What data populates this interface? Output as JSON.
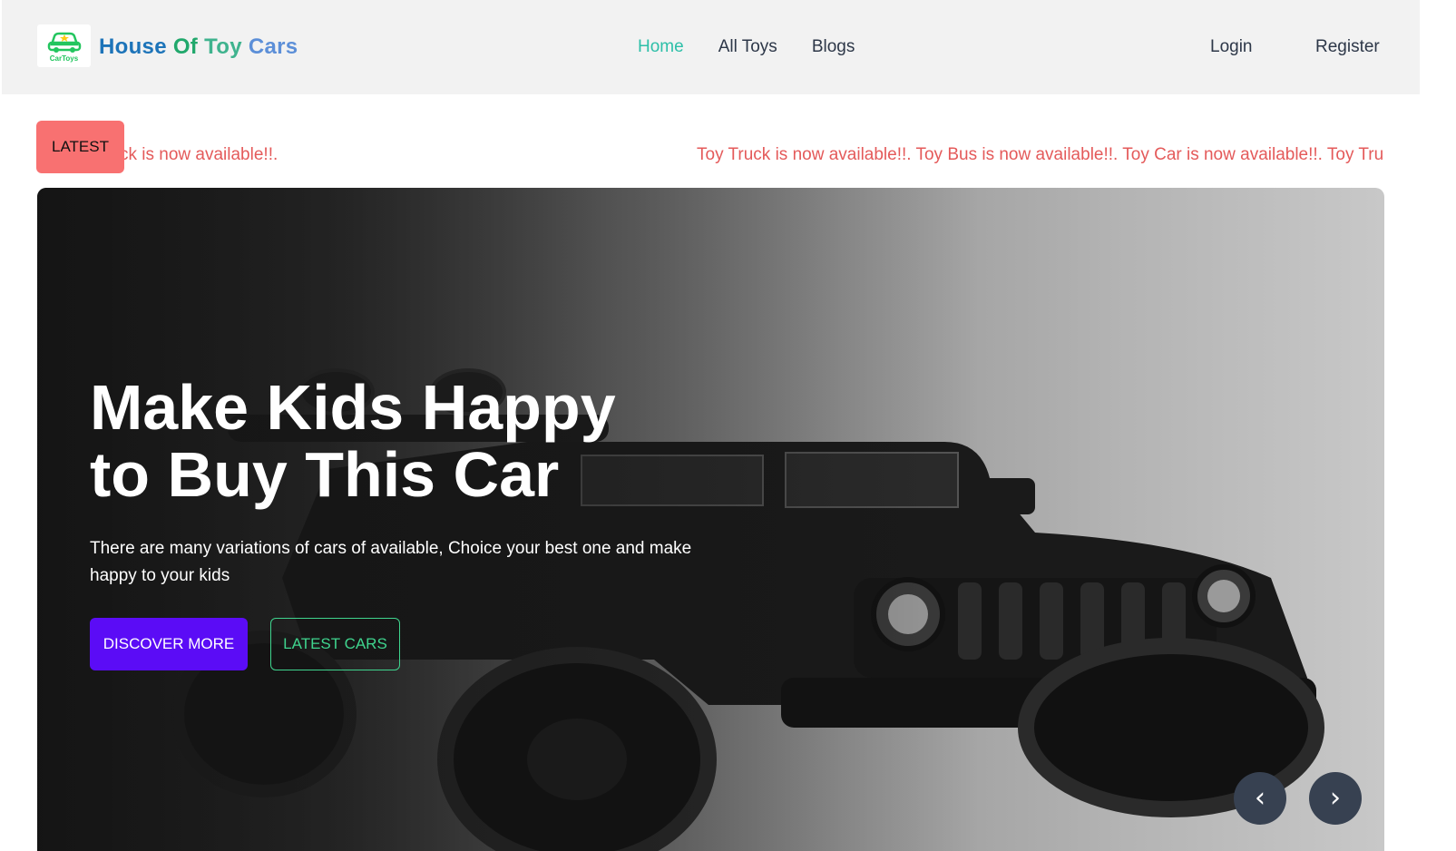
{
  "brand": {
    "logo_caption": "CarToys",
    "name_parts": [
      "House",
      "Of",
      "Toy",
      "Cars"
    ]
  },
  "nav": {
    "items": [
      {
        "label": "Home",
        "active": true
      },
      {
        "label": "All Toys",
        "active": false
      },
      {
        "label": "Blogs",
        "active": false
      }
    ],
    "login": "Login",
    "register": "Register"
  },
  "ticker": {
    "badge": "LATEST",
    "text_a": "ck is now available!!.",
    "text_b": "Toy Truck is now available!!. Toy Bus is now available!!. Toy Car is now available!!. Toy Truck is now available!!."
  },
  "hero": {
    "title_line1": "Make Kids Happy",
    "title_line2": "to Buy This Car",
    "description": "There are many variations of cars of available, Choice your best one and make happy to your kids",
    "discover_label": "DISCOVER MORE",
    "latest_label": "LATEST CARS",
    "prev_symbol": "‹",
    "next_symbol": "›"
  },
  "colors": {
    "active_nav": "#2dbfa8",
    "badge": "#f87171",
    "ticker_text": "#e45a5a",
    "primary_button": "#5b0cf6",
    "outline_button": "#3fd48e"
  }
}
